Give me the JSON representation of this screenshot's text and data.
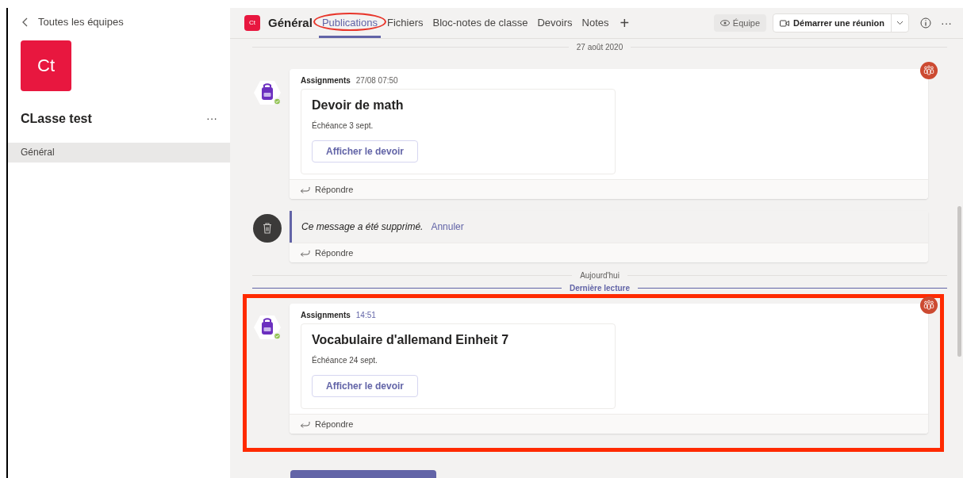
{
  "sidebar": {
    "back_label": "Toutes les équipes",
    "team_initials": "Ct",
    "team_name": "CLasse test",
    "more": "···",
    "channels": [
      {
        "label": "Général",
        "selected": true
      }
    ]
  },
  "header": {
    "channel_initials": "Ct",
    "channel_name": "Général",
    "tabs": [
      {
        "label": "Publications",
        "selected": true,
        "circled": true
      },
      {
        "label": "Fichiers",
        "selected": false,
        "circled": false
      },
      {
        "label": "Bloc-notes de classe",
        "selected": false,
        "circled": false
      },
      {
        "label": "Devoirs",
        "selected": false,
        "circled": false
      },
      {
        "label": "Notes",
        "selected": false,
        "circled": false
      }
    ],
    "add_tab": "+",
    "team_button": "Équipe",
    "meeting_button": "Démarrer une réunion",
    "more": "···"
  },
  "feed": [
    {
      "kind": "date_divider",
      "label": "27 août 2020"
    },
    {
      "kind": "message",
      "sender": "Assignments",
      "time": "27/08 07:50",
      "unread": false,
      "highlighted": false,
      "title": "Devoir de math",
      "due": "Échéance 3 sept.",
      "button": "Afficher le devoir",
      "reply": "Répondre"
    },
    {
      "kind": "deleted",
      "text": "Ce message a été supprimé.",
      "undo": "Annuler",
      "reply": "Répondre"
    },
    {
      "kind": "date_divider",
      "label": "Aujourd'hui"
    },
    {
      "kind": "unread_divider",
      "label": "Dernière lecture"
    },
    {
      "kind": "message",
      "sender": "Assignments",
      "time": "14:51",
      "unread": true,
      "highlighted": true,
      "title": "Vocabulaire d'allemand Einheit 7",
      "due": "Échéance 24 sept.",
      "button": "Afficher le devoir",
      "reply": "Répondre"
    }
  ]
}
